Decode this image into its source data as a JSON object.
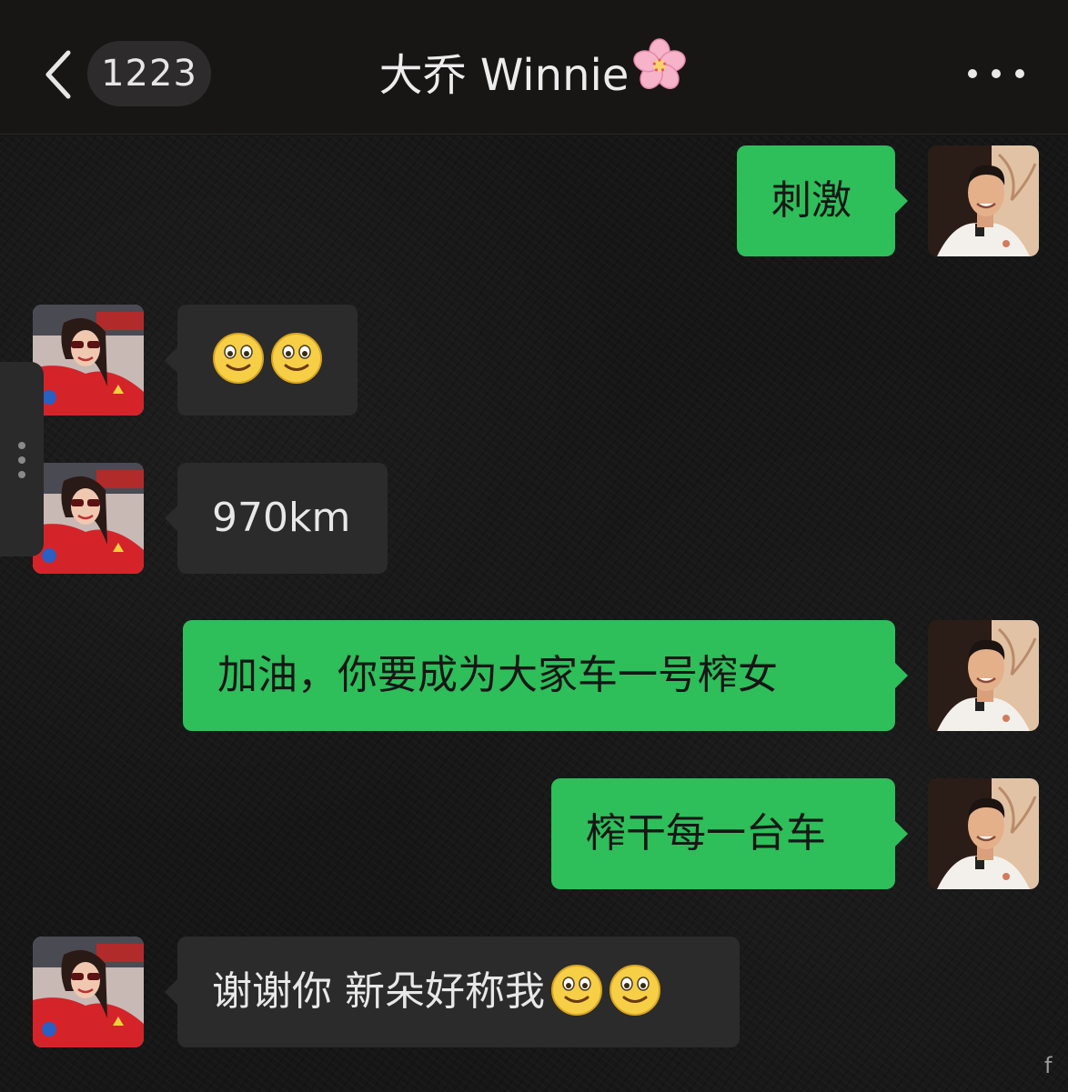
{
  "header": {
    "back_label": "",
    "unread_count": "1223",
    "title": "大乔 Winnie"
  },
  "messages": [
    {
      "from": "me",
      "text": "刺激"
    },
    {
      "from": "contact",
      "text": "",
      "emoji": [
        "slight-smile-emoji",
        "slight-smile-emoji"
      ]
    },
    {
      "from": "contact",
      "text": "970km"
    },
    {
      "from": "me",
      "text": "加油，你要成为大家车一号榨女"
    },
    {
      "from": "me",
      "text": "榨干每一台车"
    },
    {
      "from": "contact",
      "text": "谢谢你 新朵好称我",
      "emoji": [
        "slight-smile-emoji",
        "slight-smile-emoji"
      ]
    }
  ],
  "icons": {
    "back": "chevron-left-icon",
    "more": "more-horizontal-icon",
    "title_decoration": "cherry-blossom-emoji",
    "side_handle": "drag-handle-icon"
  },
  "colors": {
    "outgoing_bubble": "#2ebe5a",
    "incoming_bubble": "#2b2b2b",
    "header_bg": "#181515",
    "chat_bg": "#161616"
  },
  "watermark": "f"
}
